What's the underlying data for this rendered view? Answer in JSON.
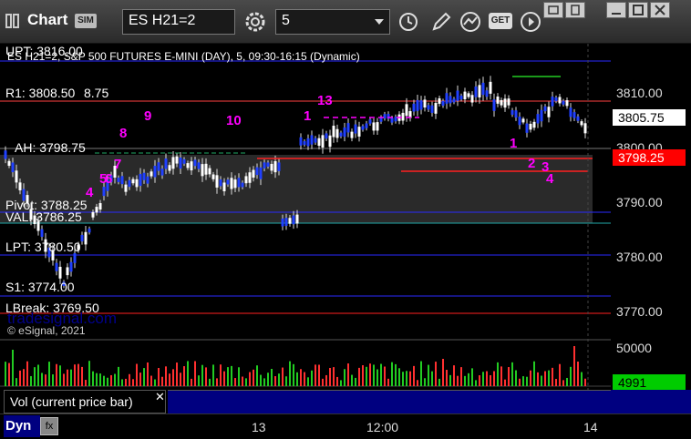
{
  "app": {
    "title": "Chart",
    "badge": "SIM"
  },
  "toolbar": {
    "symbol": "ES H21=2",
    "interval": "5",
    "icons": [
      "gear-icon",
      "clock-icon",
      "pencil-icon",
      "indicator-icon",
      "get-icon",
      "play-icon"
    ],
    "get_label": "GET"
  },
  "chart": {
    "header": "ES H21=2, S&P 500 FUTURES E-MINI (DAY), 5, 09:30-16:15 (Dynamic)",
    "levels": {
      "upt": "UPT: 3816.00",
      "r1": "R1: 3808.50",
      "r1_extra": "8.75",
      "ah": "AH: 3798.75",
      "pivot": "Pivot: 3788.25",
      "val": "VAL: 3786.25",
      "lpt": "LPT: 3780.50",
      "s1": "S1: 3774.00",
      "lbreak": "LBreak: 3769.50"
    },
    "watermark": "tradesignal.com",
    "copyright": "© eSignal, 2021",
    "counts": [
      "7",
      "8",
      "9",
      "10",
      "13",
      "1",
      "1",
      "2",
      "3",
      "4",
      "5",
      "6",
      "4"
    ]
  },
  "price_axis": {
    "ticks": [
      "3810.00",
      "3800.00",
      "3790.00",
      "3780.00",
      "3770.00"
    ],
    "current_price": "3805.75",
    "last_price": "3798.25",
    "volume_tick": "50000",
    "volume_value": "4991"
  },
  "volume_panel": {
    "label": "Vol (current price bar)"
  },
  "time_axis": {
    "labels": [
      "13",
      "12:00",
      "14"
    ]
  },
  "status": {
    "dyn": "Dyn"
  },
  "colors": {
    "pivot_line": "#1e1e90",
    "red_line": "#ff2020",
    "count": "#ff00ff",
    "price_red": "#ff0000",
    "vol_green": "#00cc00"
  }
}
